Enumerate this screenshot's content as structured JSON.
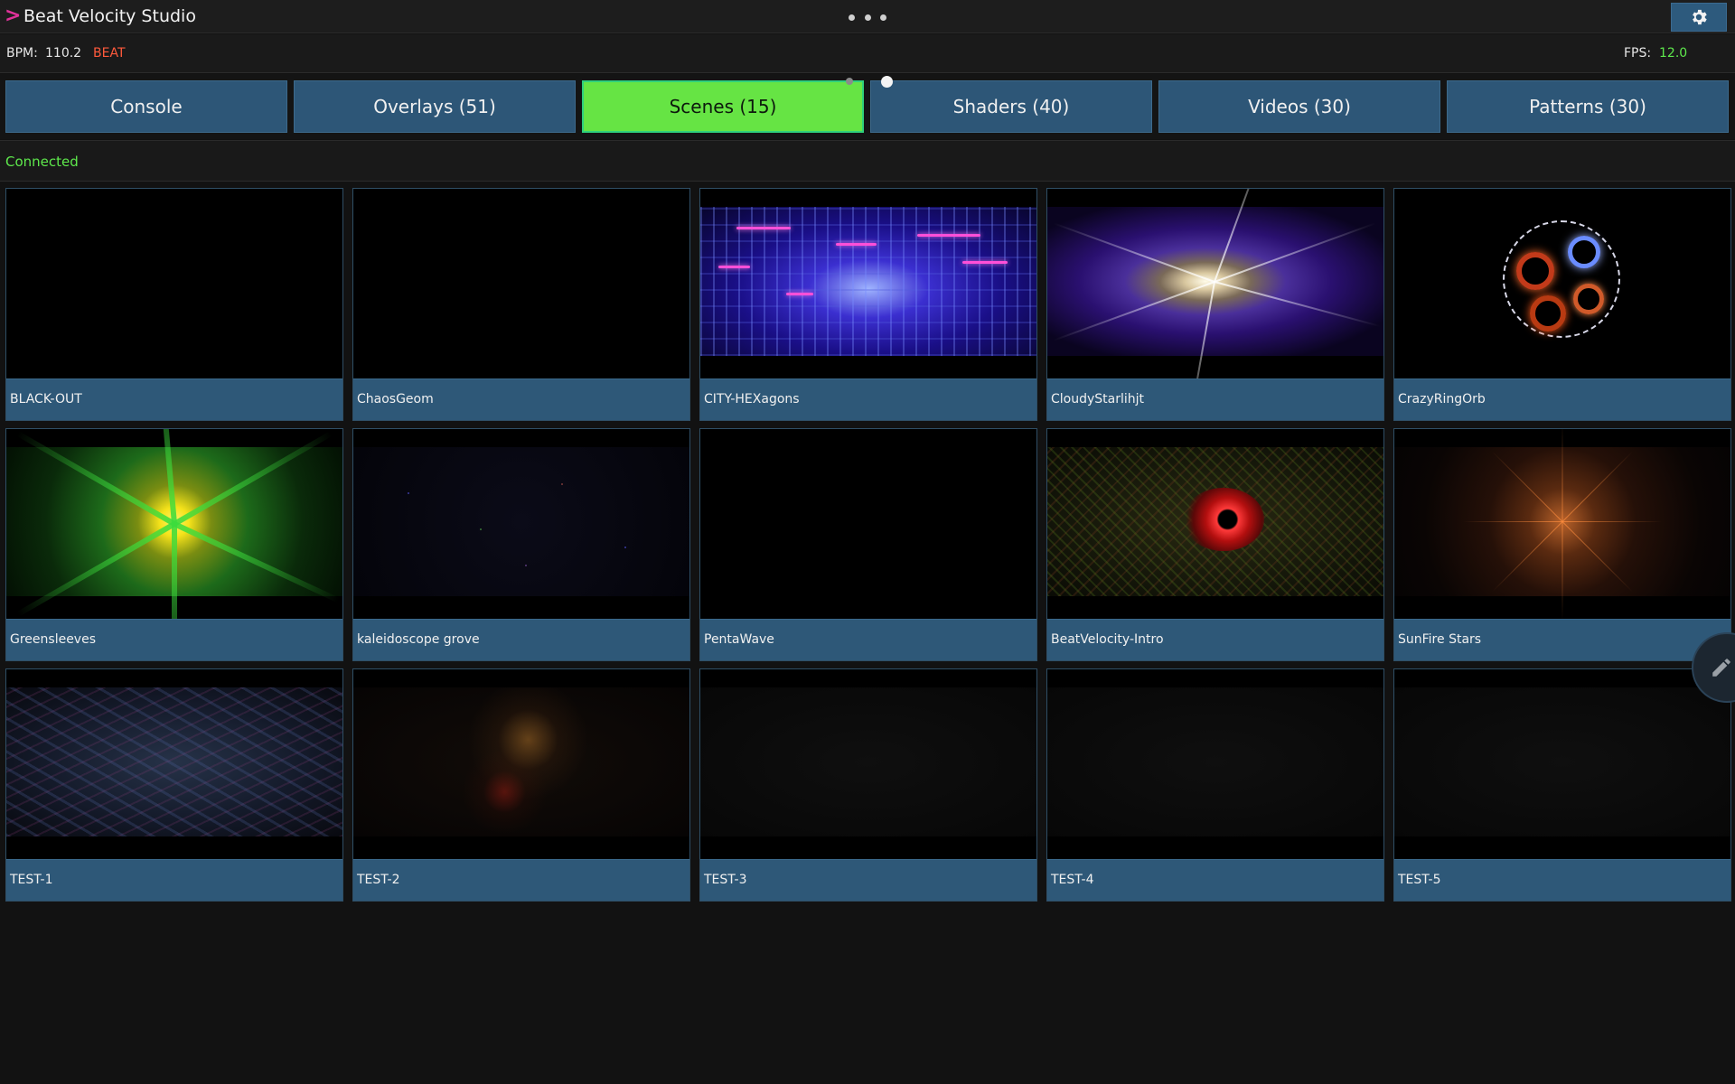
{
  "app": {
    "title": "Beat Velocity Studio",
    "caret": ">"
  },
  "info": {
    "bpm_label": "BPM:",
    "bpm_value": "110.2",
    "beat_label": "BEAT",
    "fps_label": "FPS:",
    "fps_value": "12.0"
  },
  "tabs": [
    {
      "label": "Console",
      "active": false
    },
    {
      "label": "Overlays (51)",
      "active": false
    },
    {
      "label": "Scenes (15)",
      "active": true
    },
    {
      "label": "Shaders (40)",
      "active": false
    },
    {
      "label": "Videos (30)",
      "active": false
    },
    {
      "label": "Patterns (30)",
      "active": false
    }
  ],
  "status": {
    "text": "Connected"
  },
  "scenes": [
    {
      "name": "BLACK-OUT"
    },
    {
      "name": "ChaosGeom"
    },
    {
      "name": "CITY-HEXagons"
    },
    {
      "name": "CloudyStarlihjt"
    },
    {
      "name": "CrazyRingOrb"
    },
    {
      "name": "Greensleeves"
    },
    {
      "name": "kaleidoscope grove"
    },
    {
      "name": "PentaWave"
    },
    {
      "name": "BeatVelocity-Intro"
    },
    {
      "name": "SunFire Stars"
    },
    {
      "name": "TEST-1"
    },
    {
      "name": "TEST-2"
    },
    {
      "name": "TEST-3"
    },
    {
      "name": "TEST-4"
    },
    {
      "name": "TEST-5"
    }
  ],
  "icons": {
    "settings": "gear-icon",
    "edit": "pencil-icon",
    "menu": "more-dots-icon"
  },
  "colors": {
    "accent_active_tab": "#66e444",
    "tab_bg": "#2d5677",
    "connected": "#5ee84c",
    "beat": "#ff5a3c",
    "caret": "#e0329b"
  }
}
